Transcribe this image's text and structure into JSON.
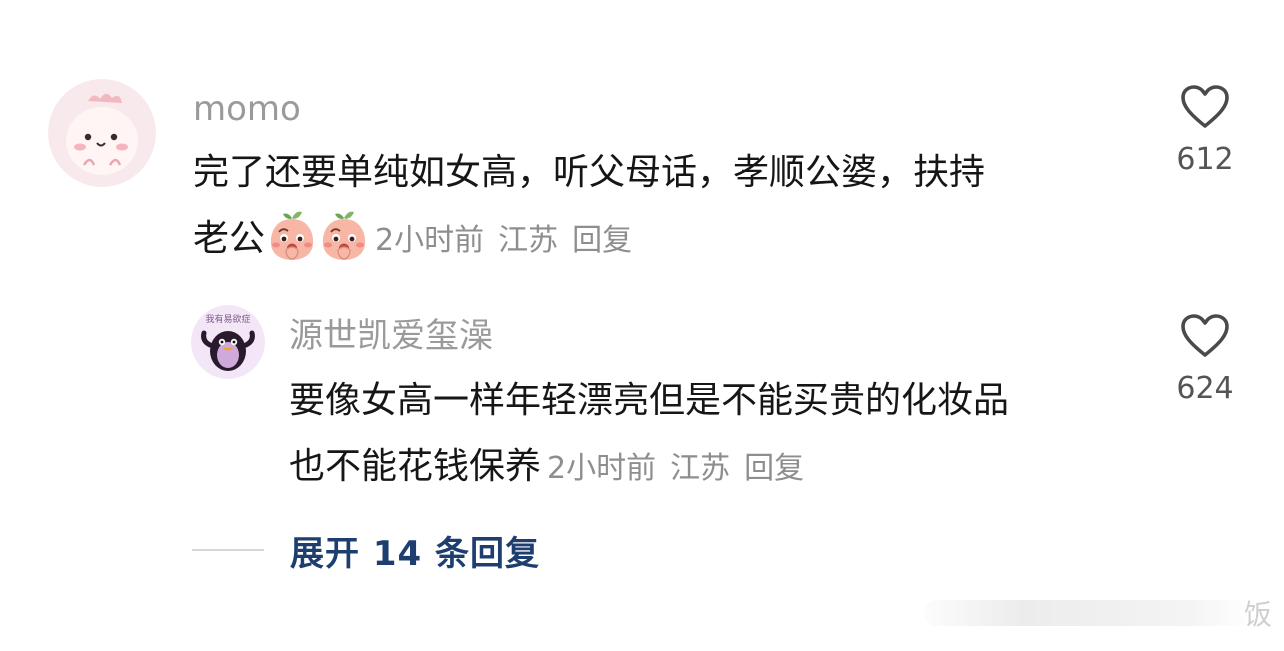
{
  "comments": [
    {
      "username": "momo",
      "text_line1": "完了还要单纯如女高，听父母话，孝顺公婆，扶持",
      "text_line2": "老公",
      "emoji": "blushing-peach-emoji",
      "time": "2小时前",
      "location": "江苏",
      "reply_label": "回复",
      "likes": "612",
      "avatar": "pink-dinosaur-avatar"
    },
    {
      "username": "源世凯爱玺澡",
      "text_line1": "要像女高一样年轻漂亮但是不能买贵的化妆品",
      "text_line2": "也不能花钱保养",
      "time": "2小时前",
      "location": "江苏",
      "reply_label": "回复",
      "likes": "624",
      "avatar": "purple-penguin-avatar",
      "avatar_text": "我有易欲症"
    }
  ],
  "expand_replies": "展开 14 条回复",
  "watermark": "饭",
  "colors": {
    "username": "#9a9a9a",
    "text": "#161616",
    "meta": "#8e8e8e",
    "expand": "#1d3e6e",
    "heart_outline": "#4a4a4a"
  }
}
